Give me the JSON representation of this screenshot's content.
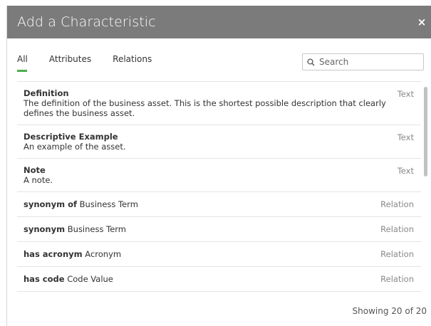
{
  "dialog": {
    "title": "Add a Characteristic",
    "close_symbol": "×"
  },
  "tabs": [
    {
      "label": "All",
      "active": true
    },
    {
      "label": "Attributes",
      "active": false
    },
    {
      "label": "Relations",
      "active": false
    }
  ],
  "search": {
    "placeholder": "Search",
    "value": "",
    "icon": "search-icon"
  },
  "items": [
    {
      "name": "Definition",
      "target": "",
      "type": "Text",
      "description": "The definition of the business asset. This is the shortest possible description that clearly defines the business asset."
    },
    {
      "name": "Descriptive Example",
      "target": "",
      "type": "Text",
      "description": "An example of the asset."
    },
    {
      "name": "Note",
      "target": "",
      "type": "Text",
      "description": "A note."
    },
    {
      "name": "synonym of",
      "target": "Business Term",
      "type": "Relation",
      "description": ""
    },
    {
      "name": "synonym",
      "target": "Business Term",
      "type": "Relation",
      "description": ""
    },
    {
      "name": "has acronym",
      "target": "Acronym",
      "type": "Relation",
      "description": ""
    },
    {
      "name": "has code",
      "target": "Code Value",
      "type": "Relation",
      "description": ""
    }
  ],
  "footer": {
    "status": "Showing 20 of 20"
  },
  "colors": {
    "titlebar": "#7b7b7b",
    "active_tab_underline": "#4cae4c"
  }
}
